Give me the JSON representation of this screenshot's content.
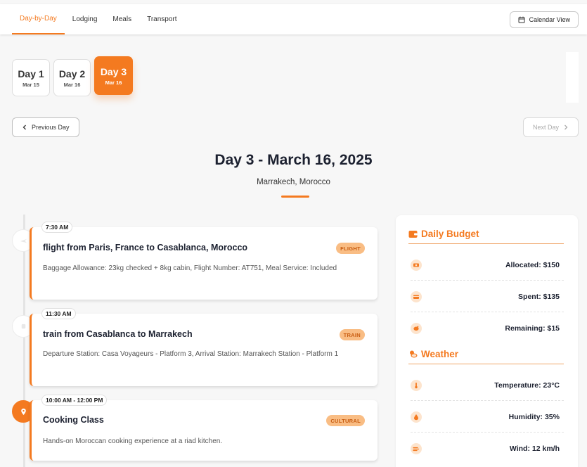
{
  "nav": {
    "tabs": [
      {
        "label": "Day-by-Day",
        "active": true
      },
      {
        "label": "Lodging"
      },
      {
        "label": "Meals"
      },
      {
        "label": "Transport"
      }
    ],
    "calendar_button": "Calendar View"
  },
  "days": [
    {
      "label": "Day 1",
      "date": "Mar 15"
    },
    {
      "label": "Day 2",
      "date": "Mar 16"
    },
    {
      "label": "Day 3",
      "date": "Mar 16",
      "active": true
    }
  ],
  "pager": {
    "prev": "Previous Day",
    "next": "Next Day"
  },
  "header": {
    "title": "Day 3 - March 16, 2025",
    "location": "Marrakech, Morocco"
  },
  "events": [
    {
      "time": "7:30 AM",
      "title": "flight from Paris, France to Casablanca, Morocco",
      "badge": "FLIGHT",
      "desc": "Baggage Allowance: 23kg checked + 8kg cabin, Flight Number: AT751, Meal Service: Included",
      "icon": "plane-icon"
    },
    {
      "time": "11:30 AM",
      "title": "train from Casablanca to Marrakech",
      "badge": "TRAIN",
      "desc": "Departure Station: Casa Voyageurs - Platform 3, Arrival Station: Marrakech Station - Platform 1",
      "icon": "train-icon"
    },
    {
      "time": "10:00 AM - 12:00 PM",
      "title": "Cooking Class",
      "badge": "CULTURAL",
      "desc": "Hands-on Moroccan cooking experience at a riad kitchen.",
      "icon": "map-pin-icon"
    }
  ],
  "budget": {
    "heading": "Daily Budget",
    "rows": [
      {
        "label": "Allocated: $150",
        "icon": "money-icon"
      },
      {
        "label": "Spent: $135",
        "icon": "credit-card-icon"
      },
      {
        "label": "Remaining: $15",
        "icon": "piggy-bank-icon"
      }
    ]
  },
  "weather": {
    "heading": "Weather",
    "rows": [
      {
        "label": "Temperature: 23°C",
        "icon": "thermometer-icon"
      },
      {
        "label": "Humidity: 35%",
        "icon": "droplet-icon"
      },
      {
        "label": "Wind: 12 km/h",
        "icon": "wind-icon"
      }
    ]
  },
  "colors": {
    "accent": "#f47a20",
    "badge_bg": "#f9bd84"
  }
}
